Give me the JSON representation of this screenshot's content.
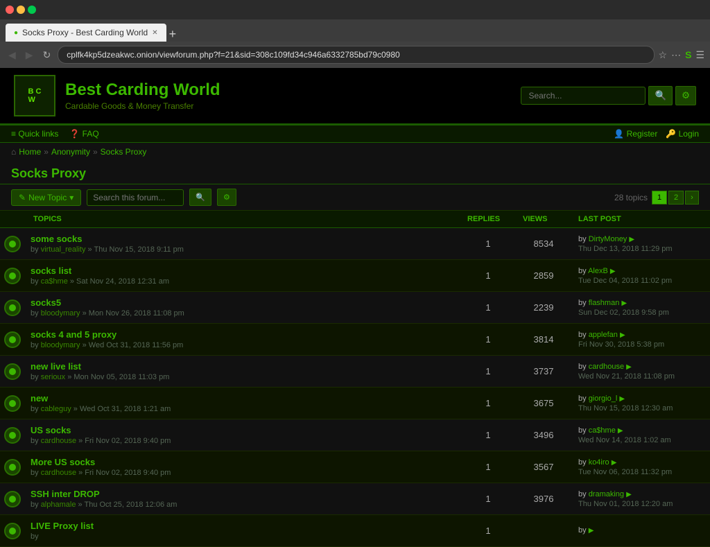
{
  "browser": {
    "tab_title": "Socks Proxy - Best Carding World",
    "url": "cplfk4kp5dzeakwc.onion/viewforum.php?f=21&sid=308c109fd34c946a6332785bd79c0980",
    "nav_back": "◀",
    "nav_forward": "▶",
    "nav_refresh": "↻",
    "nav_home": "⌂"
  },
  "header": {
    "logo_text": "B C W",
    "site_title": "Best Carding World",
    "site_tagline": "Cardable Goods & Money Transfer",
    "search_placeholder": "Search..."
  },
  "navbar": {
    "quick_links": "Quick links",
    "faq": "FAQ",
    "register": "Register",
    "login": "Login"
  },
  "breadcrumb": {
    "home": "Home",
    "sep1": "»",
    "anonymity": "Anonymity",
    "sep2": "»",
    "socks_proxy": "Socks Proxy"
  },
  "page": {
    "title": "Socks Proxy",
    "new_topic": "New Topic",
    "search_placeholder": "Search this forum...",
    "topic_count": "28 topics",
    "columns": {
      "topics": "TOPICS",
      "replies": "REPLIES",
      "views": "VIEWS",
      "last_post": "LAST POST"
    }
  },
  "pagination": {
    "page1": "1",
    "page2": "2",
    "next": "›"
  },
  "topics": [
    {
      "title": "some socks",
      "author": "virtual_reality",
      "date": "Thu Nov 15, 2018 9:11 pm",
      "replies": "1",
      "views": "8534",
      "last_by": "DirtyMoney",
      "last_date": "Thu Dec 13, 2018 11:29 pm"
    },
    {
      "title": "socks list",
      "author": "ca$hme",
      "date": "Sat Nov 24, 2018 12:31 am",
      "replies": "1",
      "views": "2859",
      "last_by": "AlexB",
      "last_date": "Tue Dec 04, 2018 11:02 pm"
    },
    {
      "title": "socks5",
      "author": "bloodymary",
      "date": "Mon Nov 26, 2018 11:08 pm",
      "replies": "1",
      "views": "2239",
      "last_by": "flashman",
      "last_date": "Sun Dec 02, 2018 9:58 pm"
    },
    {
      "title": "socks 4 and 5 proxy",
      "author": "bloodymary",
      "date": "Wed Oct 31, 2018 11:56 pm",
      "replies": "1",
      "views": "3814",
      "last_by": "applefan",
      "last_date": "Fri Nov 30, 2018 5:38 pm"
    },
    {
      "title": "new live list",
      "author": "serioux",
      "date": "Mon Nov 05, 2018 11:03 pm",
      "replies": "1",
      "views": "3737",
      "last_by": "cardhouse",
      "last_date": "Wed Nov 21, 2018 11:08 pm"
    },
    {
      "title": "new",
      "author": "cableguy",
      "date": "Wed Oct 31, 2018 1:21 am",
      "replies": "1",
      "views": "3675",
      "last_by": "giorgio_l",
      "last_date": "Thu Nov 15, 2018 12:30 am"
    },
    {
      "title": "US socks",
      "author": "cardhouse",
      "date": "Fri Nov 02, 2018 9:40 pm",
      "replies": "1",
      "views": "3496",
      "last_by": "ca$hme",
      "last_date": "Wed Nov 14, 2018 1:02 am"
    },
    {
      "title": "More US socks",
      "author": "cardhouse",
      "date": "Fri Nov 02, 2018 9:40 pm",
      "replies": "1",
      "views": "3567",
      "last_by": "ko4iro",
      "last_date": "Tue Nov 06, 2018 11:32 pm"
    },
    {
      "title": "SSH inter DROP",
      "author": "alphamale",
      "date": "Thu Oct 25, 2018 12:06 am",
      "replies": "1",
      "views": "3976",
      "last_by": "dramaking",
      "last_date": "Thu Nov 01, 2018 12:20 am"
    },
    {
      "title": "LIVE Proxy list",
      "author": "",
      "date": "",
      "replies": "1",
      "views": "",
      "last_by": "",
      "last_date": ""
    }
  ]
}
